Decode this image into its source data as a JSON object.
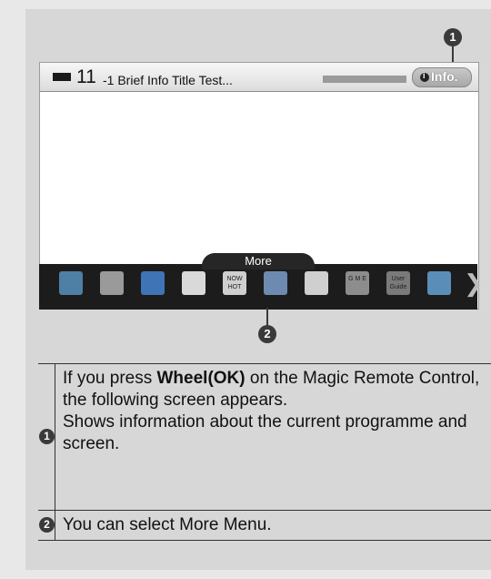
{
  "tv_screen": {
    "channel_number": "11",
    "channel_suffix": "-1 Brief Info Title Test...",
    "info_button": "Info.",
    "info_icon": "info-i-icon",
    "more_tab": "More",
    "menu_icons": [
      {
        "name": "input-list-icon",
        "color": "#4e7fa5"
      },
      {
        "name": "settings-gear-icon",
        "color": "#9a9a9a"
      },
      {
        "name": "internet-globe-icon",
        "color": "#3f74b6"
      },
      {
        "name": "search-icon",
        "color": "#d9d9d9"
      },
      {
        "name": "now-hot-icon",
        "color": "#cfcfcf",
        "text": "NOW HOT"
      },
      {
        "name": "smartshare-icon",
        "color": "#6d8bb0"
      },
      {
        "name": "clock-icon",
        "color": "#cfcfcf"
      },
      {
        "name": "game-icon",
        "color": "#8d8d8d",
        "text": "G M E"
      },
      {
        "name": "user-guide-icon",
        "color": "#7a7a7a",
        "text": "User Guide"
      },
      {
        "name": "photo-icon",
        "color": "#5a8eb8"
      }
    ],
    "menu_arrow": "❯"
  },
  "callouts": {
    "one": "1",
    "two": "2"
  },
  "table": {
    "row1": {
      "marker": "1",
      "pre": "If you press ",
      "bold": "Wheel(OK)",
      "post": " on the Magic Remote Control, the following screen appears.",
      "line2": "Shows information about the current programme and screen."
    },
    "row2": {
      "marker": "2",
      "text": "You can select More Menu."
    }
  }
}
